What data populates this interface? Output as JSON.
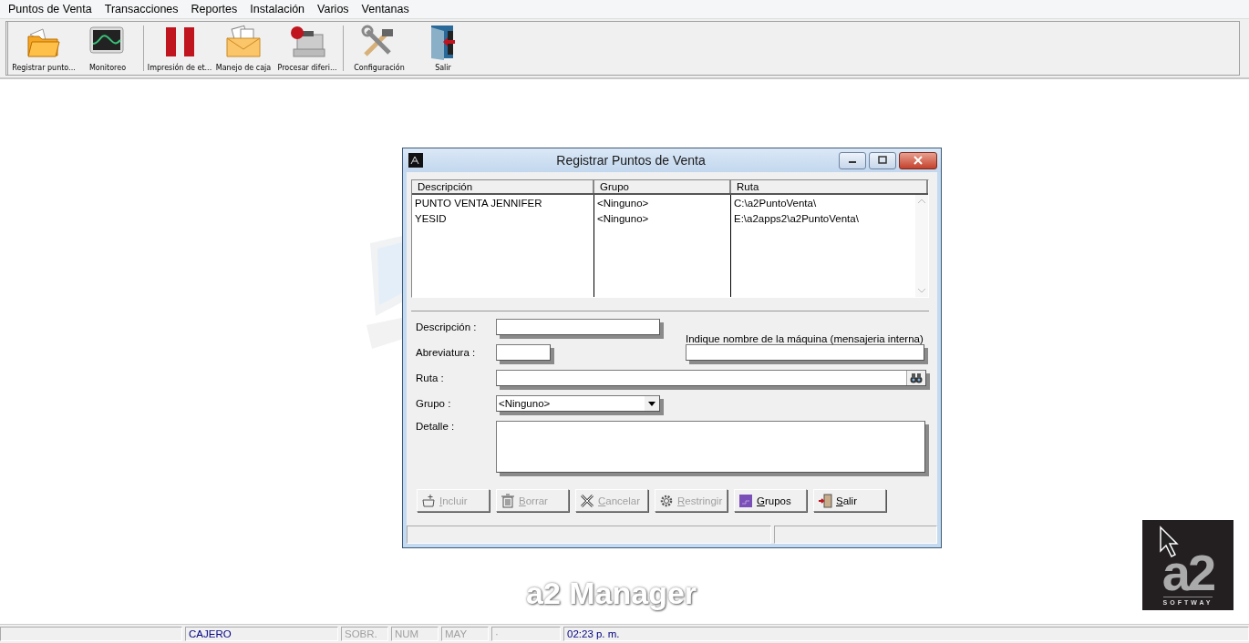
{
  "menu": [
    "Puntos de Venta",
    "Transacciones",
    "Reportes",
    "Instalación",
    "Varios",
    "Ventanas"
  ],
  "toolbar": [
    [
      "Registrar punto...",
      "Monitoreo"
    ],
    [
      "Impresión de et...",
      "Manejo de caja",
      "Procesar diferi..."
    ],
    [
      "Configuración",
      "Salir"
    ]
  ],
  "background": {
    "title": "a2 Manager",
    "logo": {
      "mark": "a2",
      "name": "SOFTWAY"
    }
  },
  "dialog": {
    "title": "Registrar Puntos de Venta",
    "table": {
      "columns": [
        "Descripción",
        "Grupo",
        "Ruta"
      ],
      "rows": [
        [
          "PUNTO VENTA JENNIFER",
          "<Ninguno>",
          "C:\\a2PuntoVenta\\"
        ],
        [
          "YESID",
          "<Ninguno>",
          "E:\\a2apps2\\a2PuntoVenta\\"
        ]
      ]
    },
    "form": {
      "descripcion": {
        "label": "Descripción :"
      },
      "abreviatura": {
        "label": "Abreviatura :"
      },
      "maquina": {
        "label": "Indique nombre de la máquina (mensajeria interna)"
      },
      "ruta": {
        "label": "Ruta :"
      },
      "grupo": {
        "label": "Grupo :",
        "value": "<Ninguno>"
      },
      "detalle": {
        "label": "Detalle :"
      }
    },
    "buttons": [
      {
        "label": "Incluir",
        "disabled": true
      },
      {
        "label": "Borrar",
        "disabled": true
      },
      {
        "label": "Cancelar",
        "disabled": true
      },
      {
        "label": "Restringir",
        "disabled": true
      },
      {
        "label": "Grupos",
        "disabled": false
      },
      {
        "label": "Salir",
        "disabled": false
      }
    ]
  },
  "status_bar": [
    {
      "kind": "blank"
    },
    {
      "text": "CAJERO",
      "kind": "text"
    },
    {
      "text": "SOBR.",
      "kind": "indicator",
      "on": false
    },
    {
      "text": "NUM",
      "kind": "indicator",
      "on": false
    },
    {
      "text": "MAY",
      "kind": "indicator",
      "on": false
    },
    {
      "text": "·",
      "kind": "indicator",
      "on": false
    },
    {
      "text": "02:23 p. m.",
      "kind": "text"
    }
  ]
}
